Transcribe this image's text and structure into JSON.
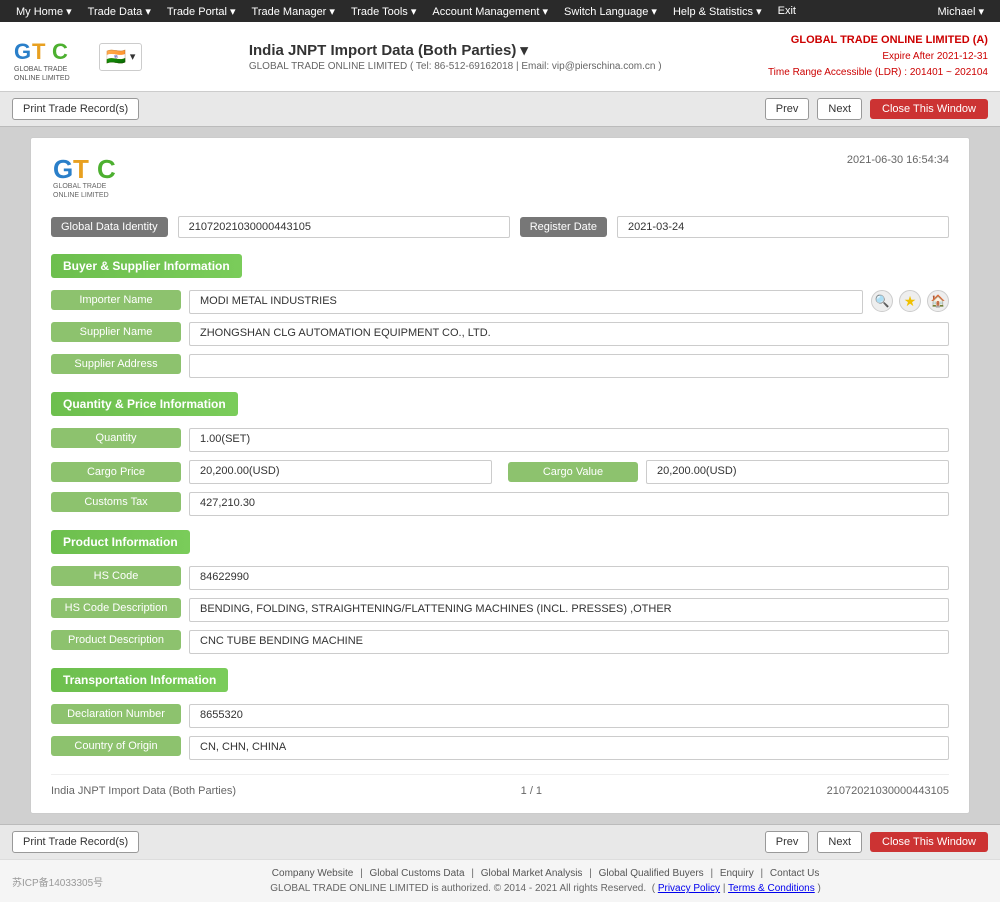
{
  "nav": {
    "items": [
      "My Home ▾",
      "Trade Data ▾",
      "Trade Portal ▾",
      "Trade Manager ▾",
      "Trade Tools ▾",
      "Account Management ▾",
      "Switch Language ▾",
      "Help & Statistics ▾",
      "Exit"
    ],
    "user": "Michael ▾"
  },
  "header": {
    "title": "India JNPT Import Data (Both Parties)",
    "dropdown_icon": "▾",
    "subtitle": "GLOBAL TRADE ONLINE LIMITED ( Tel: 86-512-69162018 | Email: vip@pierschina.com.cn )",
    "company": "GLOBAL TRADE ONLINE LIMITED (A)",
    "expire": "Expire After 2021-12-31",
    "time_range": "Time Range Accessible (LDR) : 201401 ~ 202104"
  },
  "toolbar": {
    "print_label": "Print Trade Record(s)",
    "prev_label": "Prev",
    "next_label": "Next",
    "close_label": "Close This Window"
  },
  "record": {
    "timestamp": "2021-06-30 16:54:34",
    "global_data_identity_label": "Global Data Identity",
    "global_data_identity_value": "21072021030000443105",
    "register_date_label": "Register Date",
    "register_date_value": "2021-03-24",
    "sections": {
      "buyer_supplier": {
        "title": "Buyer & Supplier Information",
        "importer_name_label": "Importer Name",
        "importer_name_value": "MODI METAL INDUSTRIES",
        "supplier_name_label": "Supplier Name",
        "supplier_name_value": "ZHONGSHAN CLG AUTOMATION EQUIPMENT CO., LTD.",
        "supplier_address_label": "Supplier Address",
        "supplier_address_value": ""
      },
      "quantity_price": {
        "title": "Quantity & Price Information",
        "quantity_label": "Quantity",
        "quantity_value": "1.00(SET)",
        "cargo_price_label": "Cargo Price",
        "cargo_price_value": "20,200.00(USD)",
        "cargo_value_label": "Cargo Value",
        "cargo_value_value": "20,200.00(USD)",
        "customs_tax_label": "Customs Tax",
        "customs_tax_value": "427,210.30"
      },
      "product": {
        "title": "Product Information",
        "hs_code_label": "HS Code",
        "hs_code_value": "84622990",
        "hs_desc_label": "HS Code Description",
        "hs_desc_value": "BENDING, FOLDING, STRAIGHTENING/FLATTENING MACHINES (INCL. PRESSES) ,OTHER",
        "product_desc_label": "Product Description",
        "product_desc_value": "CNC TUBE BENDING MACHINE"
      },
      "transportation": {
        "title": "Transportation Information",
        "declaration_number_label": "Declaration Number",
        "declaration_number_value": "8655320",
        "country_of_origin_label": "Country of Origin",
        "country_of_origin_value": "CN, CHN, CHINA"
      }
    },
    "footer_left": "India JNPT Import Data (Both Parties)",
    "footer_center": "1 / 1",
    "footer_right": "21072021030000443105"
  },
  "footer": {
    "icp": "苏ICP备14033305号",
    "links": [
      "Company Website",
      "Global Customs Data",
      "Global Market Analysis",
      "Global Qualified Buyers",
      "Enquiry",
      "Contact Us"
    ],
    "copyright": "GLOBAL TRADE ONLINE LIMITED is authorized. © 2014 - 2021 All rights Reserved.",
    "privacy": "Privacy Policy",
    "terms": "Terms & Conditions"
  }
}
